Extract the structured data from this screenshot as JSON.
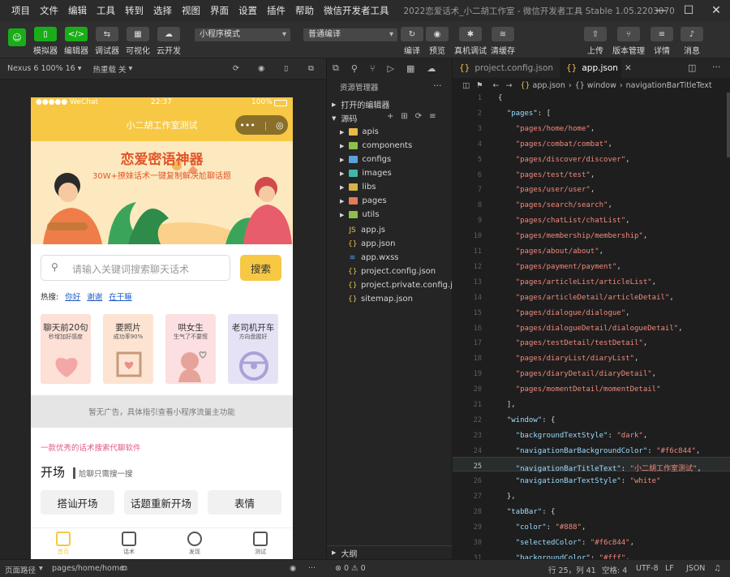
{
  "menubar": {
    "items": [
      "项目",
      "文件",
      "编辑",
      "工具",
      "转到",
      "选择",
      "视图",
      "界面",
      "设置",
      "插件",
      "帮助",
      "微信开发者工具"
    ],
    "title": "2022恋爱话术_小二胡工作室 - 微信开发者工具 Stable 1.05.2203070"
  },
  "toolbar": {
    "left": [
      "模拟器",
      "编辑器",
      "调试器",
      "可视化",
      "云开发"
    ],
    "mode_select": "小程序模式",
    "compile_select": "普通编译",
    "center": [
      "编译",
      "预览",
      "真机调试",
      "清缓存"
    ],
    "right": [
      "上传",
      "版本管理",
      "详情",
      "消息"
    ]
  },
  "simbar": {
    "device": "Nexus 6 100% 16",
    "reload": "热重载 关"
  },
  "phone": {
    "status_left": "●●●●● WeChat",
    "status_time": "22:37",
    "status_right": "100%",
    "nav_title": "小二胡工作室测试",
    "banner_title": "恋爱密语神器",
    "banner_sub": "30W+撩妹话术一键复制解决尬聊话题",
    "search_placeholder": "请输入关键词搜索聊天话术",
    "search_button": "搜索",
    "hot_label": "热搜:",
    "hot_keywords": [
      "你好",
      "谢谢",
      "在干嘛"
    ],
    "cards": [
      {
        "title": "聊天前20句",
        "sub": "秒增加好感度",
        "color": "#fde0d6"
      },
      {
        "title": "要照片",
        "sub": "成功率90%",
        "color": "#fde4d2"
      },
      {
        "title": "哄女生",
        "sub": "生气了不要慌",
        "color": "#fcdfe0"
      },
      {
        "title": "老司机开车",
        "sub": "方向盘握好",
        "color": "#e6e2f6"
      }
    ],
    "ad_text": "暂无广告，具体指引查看小程序流量主功能",
    "tagline": "一款优秀的话术搜索代聊软件",
    "section_title": "开场",
    "section_sub": "尬聊只需搜一搜",
    "chips": [
      "搭讪开场",
      "话题重新开场",
      "表情"
    ],
    "tabs": [
      "首页",
      "话术",
      "发现",
      "测试"
    ]
  },
  "explorer": {
    "title": "资源管理器",
    "open_editors": "打开的编辑器",
    "source": "源码",
    "folders": [
      {
        "name": "apis",
        "color": "#e9b949"
      },
      {
        "name": "components",
        "color": "#8fbf4a"
      },
      {
        "name": "configs",
        "color": "#5ea0d8"
      },
      {
        "name": "images",
        "color": "#3fb8a6"
      },
      {
        "name": "libs",
        "color": "#d3b54a"
      },
      {
        "name": "pages",
        "color": "#e57a5a"
      },
      {
        "name": "utils",
        "color": "#8fbf4a"
      }
    ],
    "files": [
      {
        "name": "app.js",
        "icon": "JS"
      },
      {
        "name": "app.json",
        "icon": "{}"
      },
      {
        "name": "app.wxss",
        "icon": "≋"
      },
      {
        "name": "project.config.json",
        "icon": "{}"
      },
      {
        "name": "project.private.config.js...",
        "icon": "{}"
      },
      {
        "name": "sitemap.json",
        "icon": "{}"
      }
    ],
    "outline": "大纲"
  },
  "editor": {
    "tabs": [
      "project.config.json",
      "app.json"
    ],
    "breadcrumb": [
      "app.json",
      "{} window",
      "navigationBarTitleText"
    ],
    "lines": [
      {
        "n": "1",
        "t": [
          [
            "p",
            "{"
          ]
        ]
      },
      {
        "n": "2",
        "t": [
          [
            "p",
            "  "
          ],
          [
            "k",
            "\"pages\""
          ],
          [
            "p",
            ": ["
          ]
        ]
      },
      {
        "n": "3",
        "t": [
          [
            "p",
            "    "
          ],
          [
            "s",
            "\"pages/home/home\""
          ],
          [
            "p",
            ","
          ]
        ]
      },
      {
        "n": "4",
        "t": [
          [
            "p",
            "    "
          ],
          [
            "s",
            "\"pages/combat/combat\""
          ],
          [
            "p",
            ","
          ]
        ]
      },
      {
        "n": "5",
        "t": [
          [
            "p",
            "    "
          ],
          [
            "s",
            "\"pages/discover/discover\""
          ],
          [
            "p",
            ","
          ]
        ]
      },
      {
        "n": "6",
        "t": [
          [
            "p",
            "    "
          ],
          [
            "s",
            "\"pages/test/test\""
          ],
          [
            "p",
            ","
          ]
        ]
      },
      {
        "n": "7",
        "t": [
          [
            "p",
            "    "
          ],
          [
            "s",
            "\"pages/user/user\""
          ],
          [
            "p",
            ","
          ]
        ]
      },
      {
        "n": "8",
        "t": [
          [
            "p",
            "    "
          ],
          [
            "s",
            "\"pages/search/search\""
          ],
          [
            "p",
            ","
          ]
        ]
      },
      {
        "n": "9",
        "t": [
          [
            "p",
            "    "
          ],
          [
            "s",
            "\"pages/chatList/chatList\""
          ],
          [
            "p",
            ","
          ]
        ]
      },
      {
        "n": "10",
        "t": [
          [
            "p",
            "    "
          ],
          [
            "s",
            "\"pages/membership/membership\""
          ],
          [
            "p",
            ","
          ]
        ]
      },
      {
        "n": "11",
        "t": [
          [
            "p",
            "    "
          ],
          [
            "s",
            "\"pages/about/about\""
          ],
          [
            "p",
            ","
          ]
        ]
      },
      {
        "n": "12",
        "t": [
          [
            "p",
            "    "
          ],
          [
            "s",
            "\"pages/payment/payment\""
          ],
          [
            "p",
            ","
          ]
        ]
      },
      {
        "n": "13",
        "t": [
          [
            "p",
            "    "
          ],
          [
            "s",
            "\"pages/articleList/articleList\""
          ],
          [
            "p",
            ","
          ]
        ]
      },
      {
        "n": "14",
        "t": [
          [
            "p",
            "    "
          ],
          [
            "s",
            "\"pages/articleDetail/articleDetail\""
          ],
          [
            "p",
            ","
          ]
        ]
      },
      {
        "n": "15",
        "t": [
          [
            "p",
            "    "
          ],
          [
            "s",
            "\"pages/dialogue/dialogue\""
          ],
          [
            "p",
            ","
          ]
        ]
      },
      {
        "n": "16",
        "t": [
          [
            "p",
            "    "
          ],
          [
            "s",
            "\"pages/dialogueDetail/dialogueDetail\""
          ],
          [
            "p",
            ","
          ]
        ]
      },
      {
        "n": "17",
        "t": [
          [
            "p",
            "    "
          ],
          [
            "s",
            "\"pages/testDetail/testDetail\""
          ],
          [
            "p",
            ","
          ]
        ]
      },
      {
        "n": "18",
        "t": [
          [
            "p",
            "    "
          ],
          [
            "s",
            "\"pages/diaryList/diaryList\""
          ],
          [
            "p",
            ","
          ]
        ]
      },
      {
        "n": "19",
        "t": [
          [
            "p",
            "    "
          ],
          [
            "s",
            "\"pages/diaryDetail/diaryDetail\""
          ],
          [
            "p",
            ","
          ]
        ]
      },
      {
        "n": "20",
        "t": [
          [
            "p",
            "    "
          ],
          [
            "s",
            "\"pages/momentDetail/momentDetail\""
          ]
        ]
      },
      {
        "n": "21",
        "t": [
          [
            "p",
            "  ],"
          ]
        ]
      },
      {
        "n": "22",
        "t": [
          [
            "p",
            "  "
          ],
          [
            "k",
            "\"window\""
          ],
          [
            "p",
            ": {"
          ]
        ]
      },
      {
        "n": "23",
        "t": [
          [
            "p",
            "    "
          ],
          [
            "k",
            "\"backgroundTextStyle\""
          ],
          [
            "p",
            ": "
          ],
          [
            "s",
            "\"dark\""
          ],
          [
            "p",
            ","
          ]
        ]
      },
      {
        "n": "24",
        "t": [
          [
            "p",
            "    "
          ],
          [
            "k",
            "\"navigationBarBackgroundColor\""
          ],
          [
            "p",
            ": "
          ],
          [
            "s",
            "\"#f6c844\""
          ],
          [
            "p",
            ","
          ]
        ]
      },
      {
        "n": "25",
        "t": [
          [
            "p",
            "    "
          ],
          [
            "k",
            "\"navigationBarTitleText\""
          ],
          [
            "p",
            ": "
          ],
          [
            "s",
            "\"小二胡工作室测试\""
          ],
          [
            "p",
            ","
          ]
        ]
      },
      {
        "n": "26",
        "t": [
          [
            "p",
            "    "
          ],
          [
            "k",
            "\"navigationBarTextStyle\""
          ],
          [
            "p",
            ": "
          ],
          [
            "s",
            "\"white\""
          ]
        ]
      },
      {
        "n": "27",
        "t": [
          [
            "p",
            "  },"
          ]
        ]
      },
      {
        "n": "28",
        "t": [
          [
            "p",
            "  "
          ],
          [
            "k",
            "\"tabBar\""
          ],
          [
            "p",
            ": {"
          ]
        ]
      },
      {
        "n": "29",
        "t": [
          [
            "p",
            "    "
          ],
          [
            "k",
            "\"color\""
          ],
          [
            "p",
            ": "
          ],
          [
            "s",
            "\"#888\""
          ],
          [
            "p",
            ","
          ]
        ]
      },
      {
        "n": "30",
        "t": [
          [
            "p",
            "    "
          ],
          [
            "k",
            "\"selectedColor\""
          ],
          [
            "p",
            ": "
          ],
          [
            "s",
            "\"#f6c844\""
          ],
          [
            "p",
            ","
          ]
        ]
      },
      {
        "n": "31",
        "t": [
          [
            "p",
            "    "
          ],
          [
            "k",
            "\"backgroundColor\""
          ],
          [
            "p",
            ": "
          ],
          [
            "s",
            "\"#fff\""
          ],
          [
            "p",
            ","
          ]
        ]
      }
    ]
  },
  "statusbar": {
    "path_label": "页面路径",
    "path": "pages/home/home",
    "problems": "⊗ 0 ⚠ 0",
    "position": "行 25，列 41",
    "spaces": "空格: 4",
    "encoding": "UTF-8",
    "eol": "LF",
    "lang": "JSON"
  },
  "colors": {
    "accent": "#1aad19",
    "brand": "#f6c844"
  }
}
